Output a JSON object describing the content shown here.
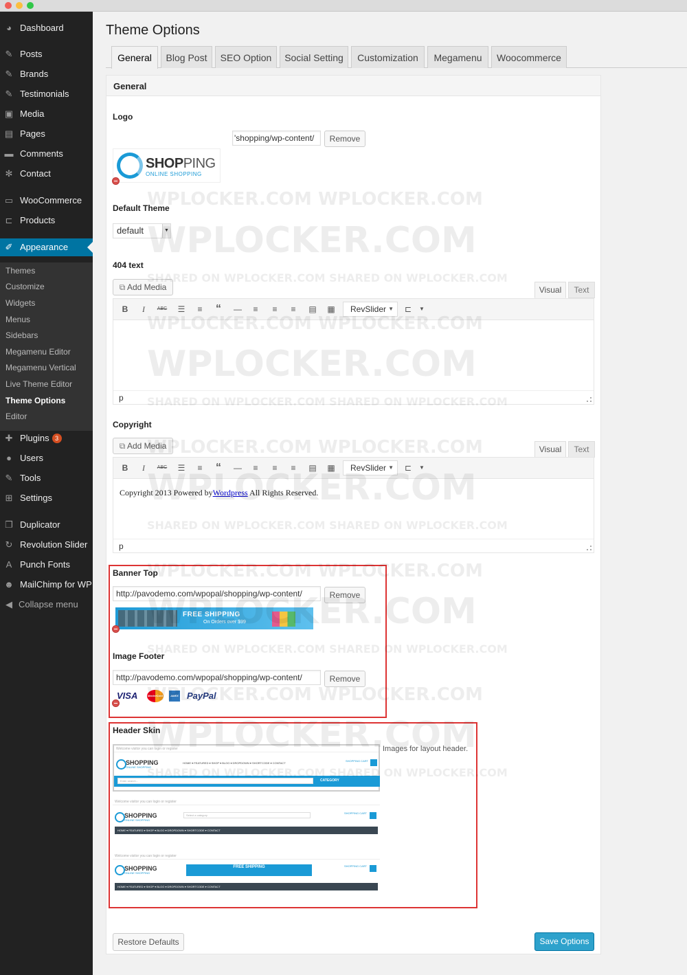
{
  "sidebar": {
    "items": [
      {
        "label": "Dashboard",
        "icon": "dashboard-icon"
      },
      {
        "label": "Posts",
        "icon": "pin-icon"
      },
      {
        "label": "Brands",
        "icon": "pin-icon"
      },
      {
        "label": "Testimonials",
        "icon": "pin-icon"
      },
      {
        "label": "Media",
        "icon": "media-icon"
      },
      {
        "label": "Pages",
        "icon": "pages-icon"
      },
      {
        "label": "Comments",
        "icon": "comments-icon"
      },
      {
        "label": "Contact",
        "icon": "gear-icon"
      },
      {
        "label": "WooCommerce",
        "icon": "woo-icon"
      },
      {
        "label": "Products",
        "icon": "cart-icon"
      },
      {
        "label": "Appearance",
        "icon": "brush-icon"
      }
    ],
    "submenu": [
      "Themes",
      "Customize",
      "Widgets",
      "Menus",
      "Sidebars",
      "Megamenu Editor",
      "Megamenu Vertical",
      "Live Theme Editor",
      "Theme Options",
      "Editor"
    ],
    "items_after": [
      {
        "label": "Plugins",
        "icon": "plugin-icon",
        "badge": "3"
      },
      {
        "label": "Users",
        "icon": "users-icon"
      },
      {
        "label": "Tools",
        "icon": "wrench-icon"
      },
      {
        "label": "Settings",
        "icon": "settings-icon"
      },
      {
        "label": "Duplicator",
        "icon": "copy-icon"
      },
      {
        "label": "Revolution Slider",
        "icon": "refresh-icon"
      },
      {
        "label": "Punch Fonts",
        "icon": "font-icon"
      },
      {
        "label": "MailChimp for WP",
        "icon": "mailchimp-icon"
      },
      {
        "label": "Collapse menu",
        "icon": "collapse-icon"
      }
    ]
  },
  "page": {
    "title": "Theme Options",
    "tabs": [
      "General",
      "Blog Post",
      "SEO Option",
      "Social Setting",
      "Customization",
      "Megamenu",
      "Woocommerce"
    ],
    "active_tab": "General"
  },
  "panel": {
    "heading": "General",
    "logo": {
      "label": "Logo",
      "value": "'shopping/wp-content/",
      "remove": "Remove",
      "brand_a": "SHOP",
      "brand_b": "PING",
      "brand_sub": "ONLINE SHOPPING"
    },
    "default_theme": {
      "label": "Default Theme",
      "value": "default"
    },
    "text404": {
      "label": "404 text",
      "add_media": "Add Media",
      "visual": "Visual",
      "text": "Text",
      "revslider": "RevSlider",
      "path": "p"
    },
    "copyright": {
      "label": "Copyright",
      "add_media": "Add Media",
      "visual": "Visual",
      "text": "Text",
      "revslider": "RevSlider",
      "content_before": "Copyright 2013 Powered by",
      "content_link": "Wordpress",
      "content_after": " All Rights Reserved.",
      "path": "p"
    },
    "banner_top": {
      "label": "Banner Top",
      "value": "http://pavodemo.com/wpopal/shopping/wp-content/",
      "remove": "Remove",
      "banner_title": "FREE SHIPPING",
      "banner_sub": "On Orders over $99"
    },
    "image_footer": {
      "label": "Image Footer",
      "value": "http://pavodemo.com/wpopal/shopping/wp-content/",
      "remove": "Remove",
      "cards": [
        "VISA",
        "MasterCard",
        "AMEX",
        "PayPal"
      ]
    },
    "header_skin": {
      "label": "Header Skin",
      "description": "Images for layout header.",
      "topbar_text": "Welcome visitor you can login or register",
      "nav_text": "HOME ▾   FEATURED ▾   SHOP ▾   BLOG ▾   DROPDOWN ▾   SHORTCODE ▾   CONTACT",
      "search_text": "Enter search...",
      "category_text": "Select a category",
      "category_btn": "CATEGORY",
      "cart_text": "SHOPPING CART"
    },
    "restore": "Restore Defaults",
    "save": "Save Options"
  },
  "watermark": {
    "big": "WPLOCKER.COM",
    "line": "WPLOCKER.COM  WPLOCKER.COM",
    "shared": "SHARED ON WPLOCKER.COM   SHARED ON WPLOCKER.COM"
  },
  "colors": {
    "accent": "#0074a2",
    "sidebar": "#222222",
    "save": "#2ea2cc",
    "highlight_box": "#dd3333"
  }
}
